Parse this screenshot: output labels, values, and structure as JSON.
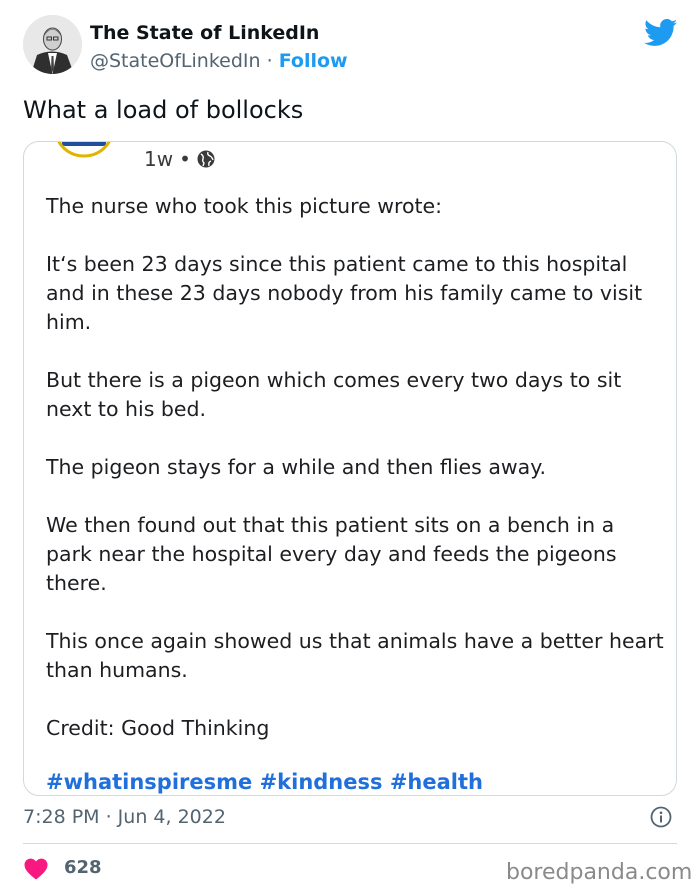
{
  "author": {
    "name": "The State of LinkedIn",
    "handle": "@StateOfLinkedIn",
    "separator": "·",
    "follow_label": "Follow"
  },
  "tweet": {
    "text": "What a load of bollocks",
    "timestamp": "7:28 PM · Jun 4, 2022",
    "likes": "628"
  },
  "embedded_post": {
    "age": "1w",
    "dot": "•",
    "paragraphs": [
      "The nurse who took this picture wrote:",
      "It‘s been 23 days since this patient came to this hospital and in these 23 days nobody from his family came to visit him.",
      "But there is a pigeon which comes every two days to sit next to his bed.",
      "The pigeon stays for a while and then flies away.",
      "We then found out that this patient sits on a bench in a park near the hospital every day and feeds the pigeons there.",
      "This once again showed us that animals have a better heart than humans.",
      "Credit: Good Thinking"
    ],
    "hashtags": "#whatinspiresme #kindness #health"
  },
  "watermark": "boredpanda.com",
  "icons": {
    "platform": "twitter-bird-icon",
    "audience": "globe-icon",
    "info": "info-icon",
    "like": "heart-icon"
  },
  "colors": {
    "accent": "#1d9bf0",
    "heart": "#f91880",
    "hashtag": "#216fdb",
    "muted": "#536471"
  }
}
